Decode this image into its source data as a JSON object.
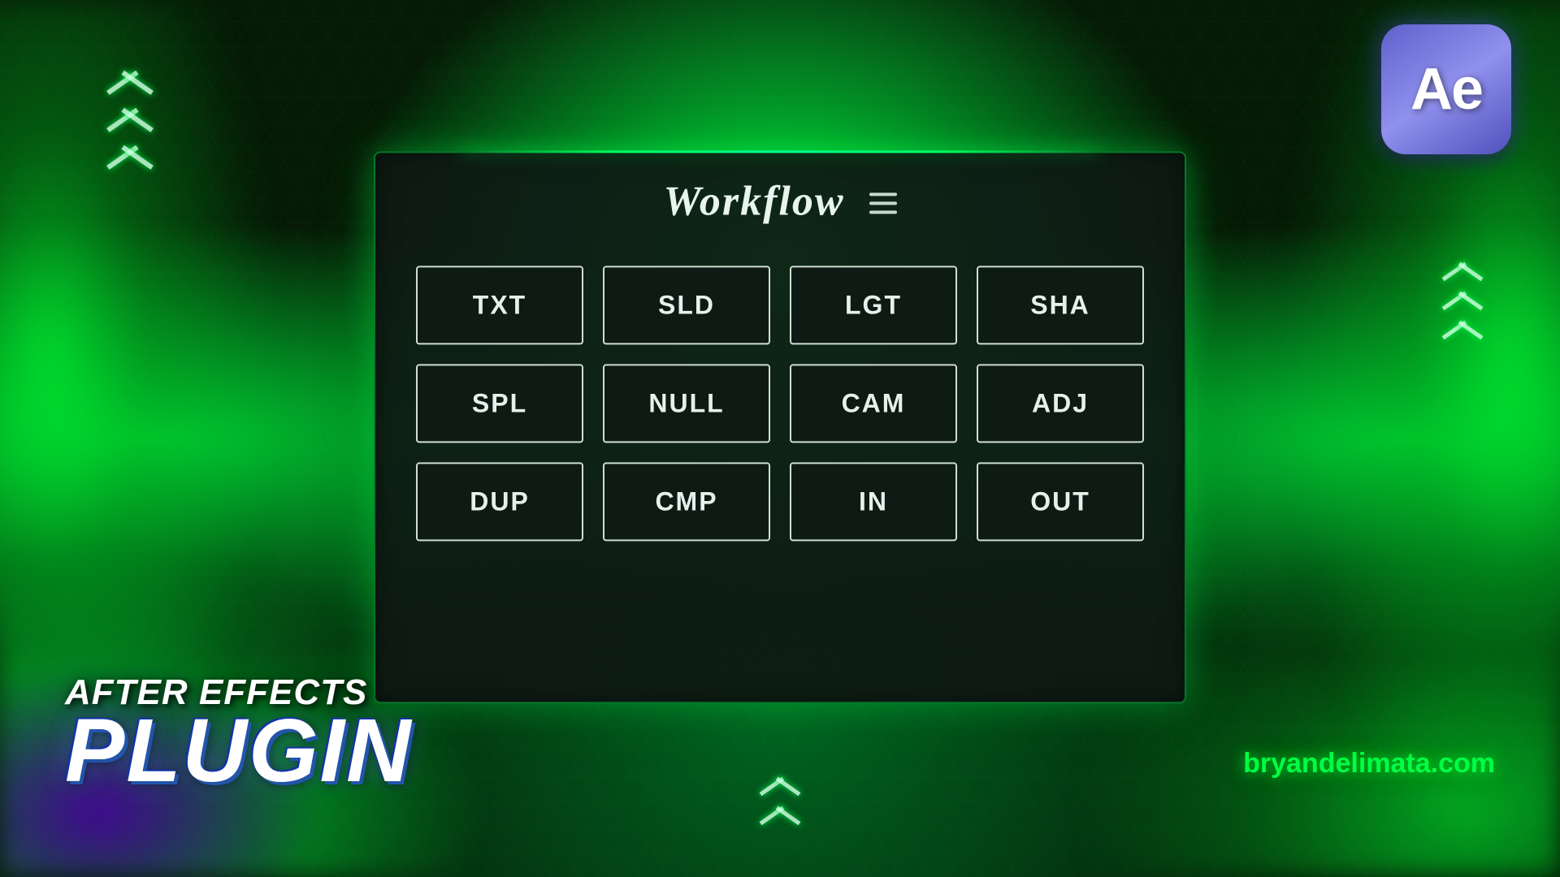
{
  "background": {
    "color": "#061a06"
  },
  "panel": {
    "title": "Workflow",
    "menu_label": "menu"
  },
  "buttons": {
    "row1": [
      {
        "label": "TXT",
        "id": "txt"
      },
      {
        "label": "SLD",
        "id": "sld"
      },
      {
        "label": "LGT",
        "id": "lgt"
      },
      {
        "label": "SHA",
        "id": "sha"
      }
    ],
    "row2": [
      {
        "label": "SPL",
        "id": "spl"
      },
      {
        "label": "NULL",
        "id": "null"
      },
      {
        "label": "CAM",
        "id": "cam"
      },
      {
        "label": "ADJ",
        "id": "adj"
      }
    ],
    "row3": [
      {
        "label": "DUP",
        "id": "dup"
      },
      {
        "label": "CMP",
        "id": "cmp"
      },
      {
        "label": "IN",
        "id": "in"
      },
      {
        "label": "OUT",
        "id": "out"
      }
    ]
  },
  "ae_logo": {
    "text": "Ae"
  },
  "bottom_left": {
    "line1": "AFTER EFFECTS",
    "line2": "PLUGIN"
  },
  "website": "bryandelimata.com"
}
